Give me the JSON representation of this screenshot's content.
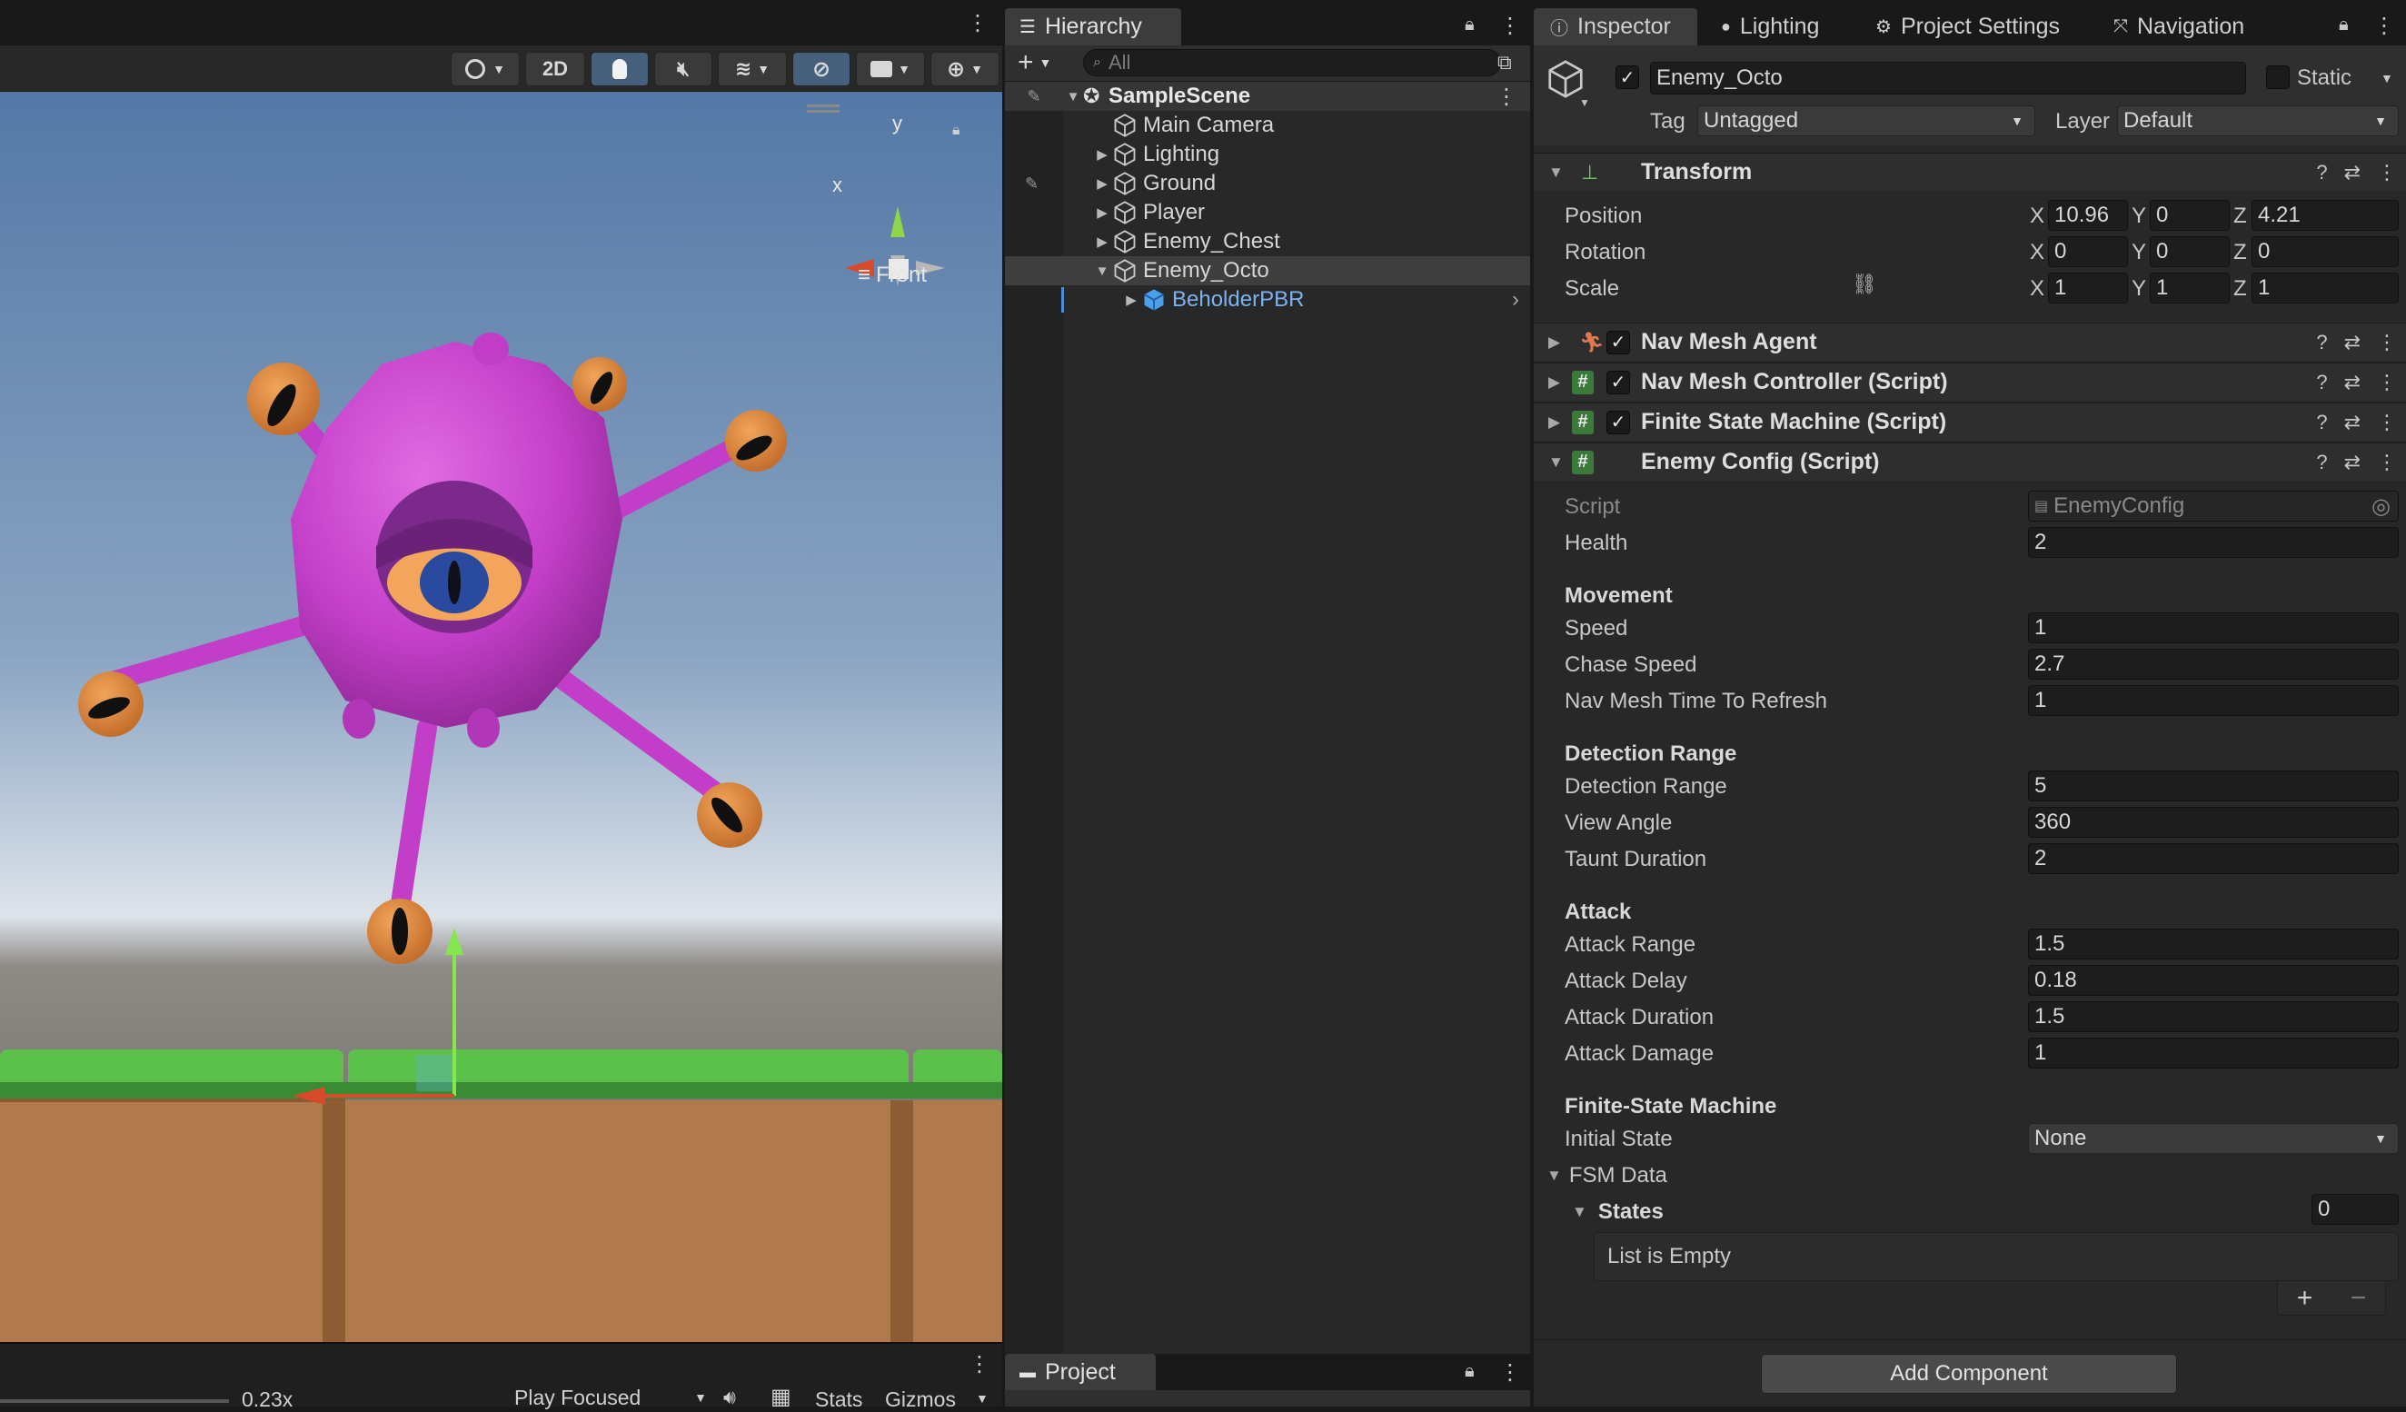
{
  "scene_view": {
    "toolbar": {
      "mode_2d": "2D"
    },
    "gizmo": {
      "y_label": "y",
      "x_label": "x",
      "view_label": "Front"
    },
    "game_bar": {
      "scale": "0.23x",
      "play_mode": "Play Focused",
      "stats": "Stats",
      "gizmos": "Gizmos"
    }
  },
  "hierarchy": {
    "tab_label": "Hierarchy",
    "search_placeholder": "All",
    "scene_name": "SampleScene",
    "items": [
      {
        "label": "Main Camera"
      },
      {
        "label": "Lighting"
      },
      {
        "label": "Ground"
      },
      {
        "label": "Player"
      },
      {
        "label": "Enemy_Chest"
      },
      {
        "label": "Enemy_Octo"
      },
      {
        "label": "BeholderPBR"
      }
    ],
    "project_tab": "Project"
  },
  "inspector": {
    "tabs": [
      "Inspector",
      "Lighting",
      "Project Settings",
      "Navigation"
    ],
    "object_name": "Enemy_Octo",
    "static_label": "Static",
    "tag_label": "Tag",
    "tag_value": "Untagged",
    "layer_label": "Layer",
    "layer_value": "Default",
    "transform": {
      "title": "Transform",
      "rows": [
        {
          "label": "Position",
          "x": "10.96",
          "y": "0",
          "z": "4.21"
        },
        {
          "label": "Rotation",
          "x": "0",
          "y": "0",
          "z": "0"
        },
        {
          "label": "Scale",
          "x": "1",
          "y": "1",
          "z": "1"
        }
      ],
      "axis": {
        "x": "X",
        "y": "Y",
        "z": "Z"
      }
    },
    "components": [
      "Nav Mesh Agent",
      "Nav Mesh Controller (Script)",
      "Finite State Machine (Script)",
      "Enemy Config (Script)"
    ],
    "enemy_config": {
      "script_label": "Script",
      "script_value": "EnemyConfig",
      "health_label": "Health",
      "health_value": "2",
      "movement_header": "Movement",
      "speed_label": "Speed",
      "speed_value": "1",
      "chase_speed_label": "Chase Speed",
      "chase_speed_value": "2.7",
      "nav_refresh_label": "Nav Mesh Time To Refresh",
      "nav_refresh_value": "1",
      "detection_header": "Detection Range",
      "detection_range_label": "Detection Range",
      "detection_range_value": "5",
      "view_angle_label": "View Angle",
      "view_angle_value": "360",
      "taunt_label": "Taunt Duration",
      "taunt_value": "2",
      "attack_header": "Attack",
      "attack_range_label": "Attack Range",
      "attack_range_value": "1.5",
      "attack_delay_label": "Attack Delay",
      "attack_delay_value": "0.18",
      "attack_duration_label": "Attack Duration",
      "attack_duration_value": "1.5",
      "attack_damage_label": "Attack Damage",
      "attack_damage_value": "1",
      "fsm_header": "Finite-State Machine",
      "initial_state_label": "Initial State",
      "initial_state_value": "None",
      "fsm_data_label": "FSM Data",
      "states_label": "States",
      "states_count": "0",
      "list_empty": "List is Empty"
    },
    "add_component": "Add Component"
  },
  "colors": {
    "accent_blue": "#46607c",
    "prefab_blue": "#7cb2f0",
    "monster": "#c43fc9",
    "grass": "#5cc14a",
    "dirt": "#b0784a"
  }
}
